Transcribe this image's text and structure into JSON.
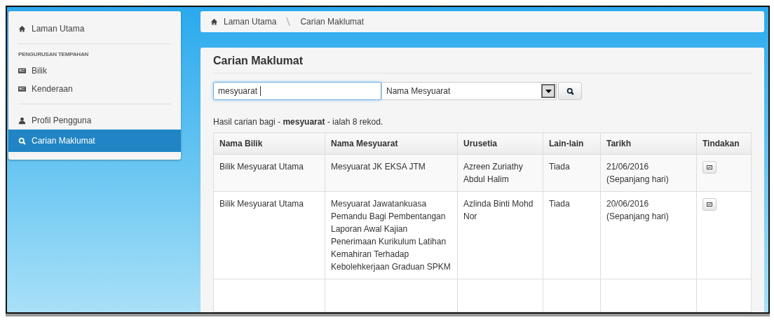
{
  "sidebar": {
    "groups": [
      {
        "items": [
          {
            "label": "Laman Utama",
            "kind": "home",
            "selected": false
          }
        ]
      },
      {
        "heading": "PENGURUSAN TEMPAHAN",
        "items": [
          {
            "label": "Bilik",
            "kind": "card",
            "selected": false
          },
          {
            "label": "Kenderaan",
            "kind": "card",
            "selected": false
          }
        ]
      },
      {
        "items": [
          {
            "label": "Profil Pengguna",
            "kind": "user",
            "selected": false
          },
          {
            "label": "Carian Maklumat",
            "kind": "search",
            "selected": true
          }
        ]
      }
    ]
  },
  "breadcrumb": [
    {
      "label": "Laman Utama",
      "kind": "home"
    },
    {
      "label": "Carian Maklumat",
      "kind": "page"
    }
  ],
  "panel": {
    "title": "Carian Maklumat",
    "search": {
      "value": "mesyuarat",
      "category": "Nama Mesyuarat"
    },
    "result": "Hasil carian bagi - **mesyuarat** - ialah 8 rekod.",
    "table": {
      "columns": [
        "Nama Bilik",
        "Nama Mesyuarat",
        "Urusetia",
        "Lain-lain",
        "Tarikh",
        "Tindakan"
      ],
      "rows": [
        [
          "Bilik Mesyuarat Utama",
          "Mesyuarat JK EKSA JTM",
          "Azreen Zuriathy Abdul Halim",
          "Tiada",
          "21/06/2016 (Sepanjang hari)"
        ],
        [
          "Bilik Mesyuarat Utama",
          "Mesyuarat Jawatankuasa Pemandu Bagi Pembentangan Laporan Awal Kajian Penerimaan Kurikulum Latihan Kemahiran Terhadap Kebolehkerjaan Graduan SPKM",
          "Azlinda Binti Mohd Nor",
          "Tiada",
          "20/06/2016 (Sepanjang hari)"
        ]
      ]
    }
  }
}
